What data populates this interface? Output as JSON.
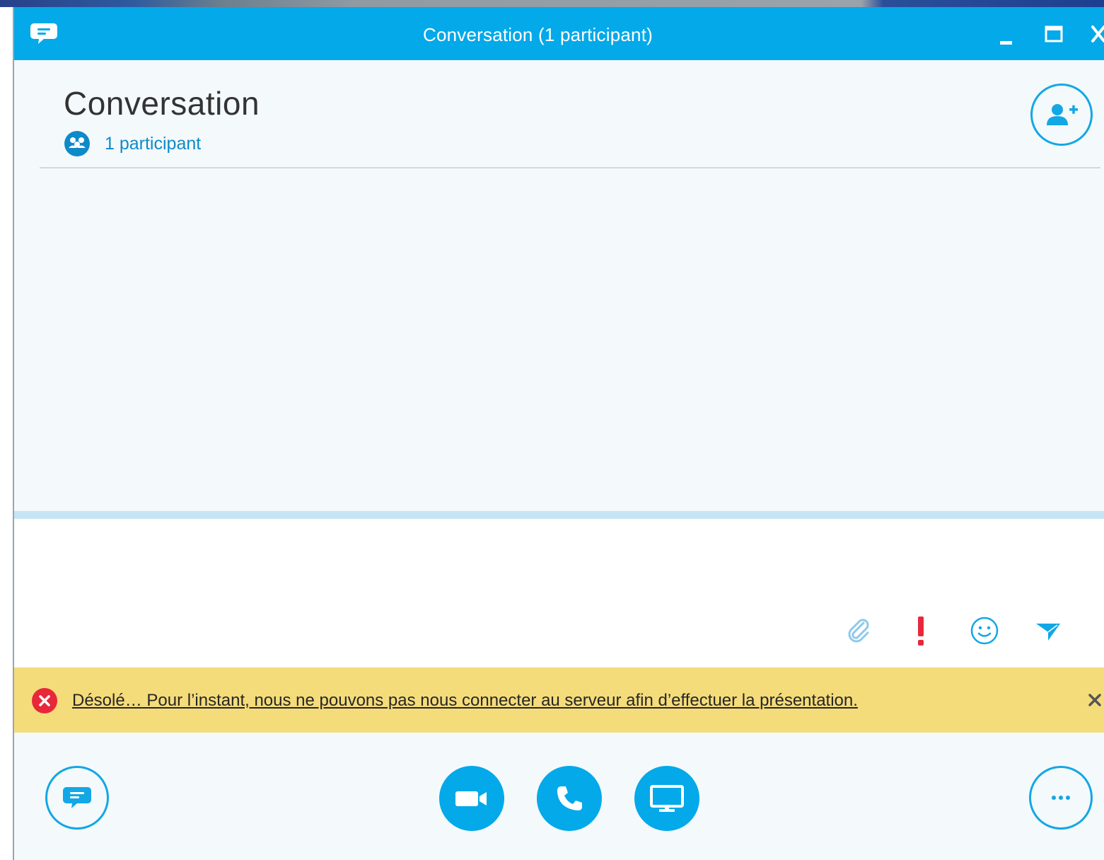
{
  "window": {
    "title": "Conversation (1 participant)"
  },
  "header": {
    "title": "Conversation",
    "participants_label": "1 participant"
  },
  "compose": {
    "message_value": ""
  },
  "error_banner": {
    "message": "Désolé… Pour l’instant, nous ne pouvons pas nous connecter au serveur afin d’effectuer la présentation."
  },
  "icons": {
    "titlebar": [
      "chat-bubble-icon",
      "minimize-icon",
      "maximize-icon",
      "close-icon"
    ],
    "header": [
      "participants-icon",
      "add-person-icon"
    ],
    "compose_tools": [
      "paperclip-icon",
      "exclamation-icon",
      "smiley-icon",
      "send-icon"
    ],
    "banner": [
      "error-icon",
      "close-icon"
    ],
    "bottom_bar": [
      "chat-bubble-icon",
      "video-camera-icon",
      "phone-icon",
      "monitor-icon",
      "ellipsis-icon"
    ]
  },
  "colors": {
    "accent": "#03a9e9",
    "link": "#0f8ac8",
    "banner": "#f5dc7a",
    "error": "#e8283a",
    "background": "#f4f9fc"
  }
}
